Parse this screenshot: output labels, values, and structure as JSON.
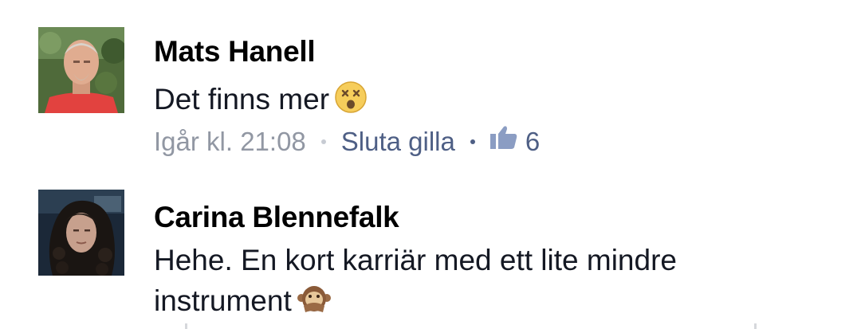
{
  "comments": [
    {
      "author": "Mats Hanell",
      "text": "Det finns mer",
      "emoji": "dizzy-face-emoji",
      "timestamp": "Igår kl. 21:08",
      "unlike_label": "Sluta gilla",
      "like_count": "6"
    },
    {
      "author": "Carina Blennefalk",
      "text_line1": "Hehe. En kort karriär med ett lite mindre",
      "text_line2": "instrument",
      "emoji": "speak-no-evil-monkey-emoji"
    }
  ],
  "colors": {
    "author": "#000000",
    "text": "#141823",
    "timestamp": "#9197a3",
    "link": "#4e5f85",
    "background": "#ffffff"
  }
}
